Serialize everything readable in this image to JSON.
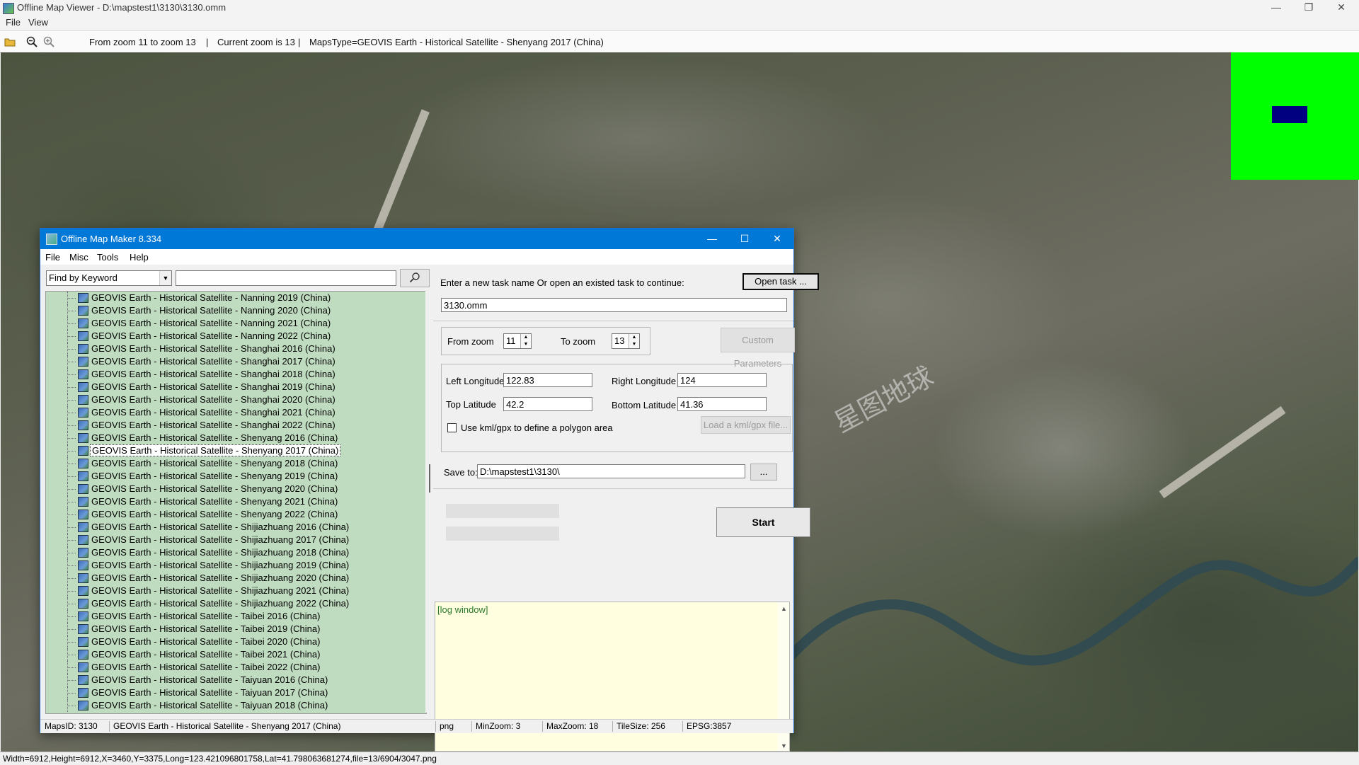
{
  "outer_window": {
    "title": "Offline Map Viewer - D:\\mapstest1\\3130\\3130.omm",
    "menu": [
      "File",
      "View"
    ],
    "toolbar": {
      "zoom_range": "From zoom 11 to zoom 13",
      "separator": "|",
      "current_zoom": "Current zoom is 13",
      "maps_type": "MapsType=GEOVIS Earth - Historical Satellite - Shenyang 2017 (China)"
    },
    "status": "Width=6912,Height=6912,X=3460,Y=3375,Long=123.421096801758,Lat=41.798063681274,file=13/6904/3047.png"
  },
  "map": {
    "watermark_text": "星图地球"
  },
  "colors": {
    "minimap_bg": "#00ff00",
    "minimap_viewport": "#000080",
    "dialog_title": "#0078d7",
    "tree_bg": "#c0dcc0",
    "log_bg": "#ffffe0"
  },
  "dialog": {
    "title": "Offline Map Maker 8.334",
    "menu": [
      "File",
      "Misc",
      "Tools",
      "Help"
    ],
    "search": {
      "type_selected": "Find by Keyword",
      "input_value": ""
    },
    "tree_items": [
      "GEOVIS Earth - Historical Satellite - Nanning 2019 (China)",
      "GEOVIS Earth - Historical Satellite - Nanning 2020 (China)",
      "GEOVIS Earth - Historical Satellite - Nanning 2021 (China)",
      "GEOVIS Earth - Historical Satellite - Nanning 2022 (China)",
      "GEOVIS Earth - Historical Satellite - Shanghai 2016 (China)",
      "GEOVIS Earth - Historical Satellite - Shanghai 2017 (China)",
      "GEOVIS Earth - Historical Satellite - Shanghai 2018 (China)",
      "GEOVIS Earth - Historical Satellite - Shanghai 2019 (China)",
      "GEOVIS Earth - Historical Satellite - Shanghai 2020 (China)",
      "GEOVIS Earth - Historical Satellite - Shanghai 2021 (China)",
      "GEOVIS Earth - Historical Satellite - Shanghai 2022 (China)",
      "GEOVIS Earth - Historical Satellite - Shenyang 2016 (China)",
      "GEOVIS Earth - Historical Satellite - Shenyang 2017 (China)",
      "GEOVIS Earth - Historical Satellite - Shenyang 2018 (China)",
      "GEOVIS Earth - Historical Satellite - Shenyang 2019 (China)",
      "GEOVIS Earth - Historical Satellite - Shenyang 2020 (China)",
      "GEOVIS Earth - Historical Satellite - Shenyang 2021 (China)",
      "GEOVIS Earth - Historical Satellite - Shenyang 2022 (China)",
      "GEOVIS Earth - Historical Satellite - Shijiazhuang 2016 (China)",
      "GEOVIS Earth - Historical Satellite - Shijiazhuang 2017 (China)",
      "GEOVIS Earth - Historical Satellite - Shijiazhuang 2018 (China)",
      "GEOVIS Earth - Historical Satellite - Shijiazhuang 2019 (China)",
      "GEOVIS Earth - Historical Satellite - Shijiazhuang 2020 (China)",
      "GEOVIS Earth - Historical Satellite - Shijiazhuang 2021 (China)",
      "GEOVIS Earth - Historical Satellite - Shijiazhuang 2022 (China)",
      "GEOVIS Earth - Historical Satellite - Taibei 2016 (China)",
      "GEOVIS Earth - Historical Satellite - Taibei 2019 (China)",
      "GEOVIS Earth - Historical Satellite - Taibei 2020 (China)",
      "GEOVIS Earth - Historical Satellite - Taibei 2021 (China)",
      "GEOVIS Earth - Historical Satellite - Taibei 2022 (China)",
      "GEOVIS Earth - Historical Satellite - Taiyuan 2016 (China)",
      "GEOVIS Earth - Historical Satellite - Taiyuan 2017 (China)",
      "GEOVIS Earth - Historical Satellite - Taiyuan 2018 (China)"
    ],
    "selected_item": "GEOVIS Earth - Historical Satellite - Shenyang 2017 (China)",
    "task": {
      "prompt": "Enter a new task name Or open an existed task to continue:",
      "open_button": "Open task ...",
      "name_value": "3130.omm"
    },
    "zoom": {
      "from_label": "From zoom",
      "from_value": "11",
      "to_label": "To zoom",
      "to_value": "13",
      "custom_button": "Custom Parameters"
    },
    "bounds": {
      "left_lon_label": "Left Longitude",
      "left_lon_value": "122.83",
      "right_lon_label": "Right Longitude",
      "right_lon_value": "124",
      "top_lat_label": "Top Latitude",
      "top_lat_value": "42.2",
      "bottom_lat_label": "Bottom Latitude",
      "bottom_lat_value": "41.36",
      "polygon_label": "Use kml/gpx to define a polygon area",
      "polygon_checked": false,
      "load_button": "Load a kml/gpx file..."
    },
    "save": {
      "label": "Save to:",
      "path": "D:\\mapstest1\\3130\\",
      "browse_button": "..."
    },
    "start_button": "Start",
    "log_label": "[log window]",
    "status": {
      "maps_id": "MapsID: 3130",
      "maps_name": "GEOVIS Earth - Historical Satellite - Shenyang 2017 (China)",
      "format": "png",
      "min_zoom": "MinZoom: 3",
      "max_zoom": "MaxZoom: 18",
      "tile_size": "TileSize: 256",
      "epsg": "EPSG:3857"
    }
  }
}
